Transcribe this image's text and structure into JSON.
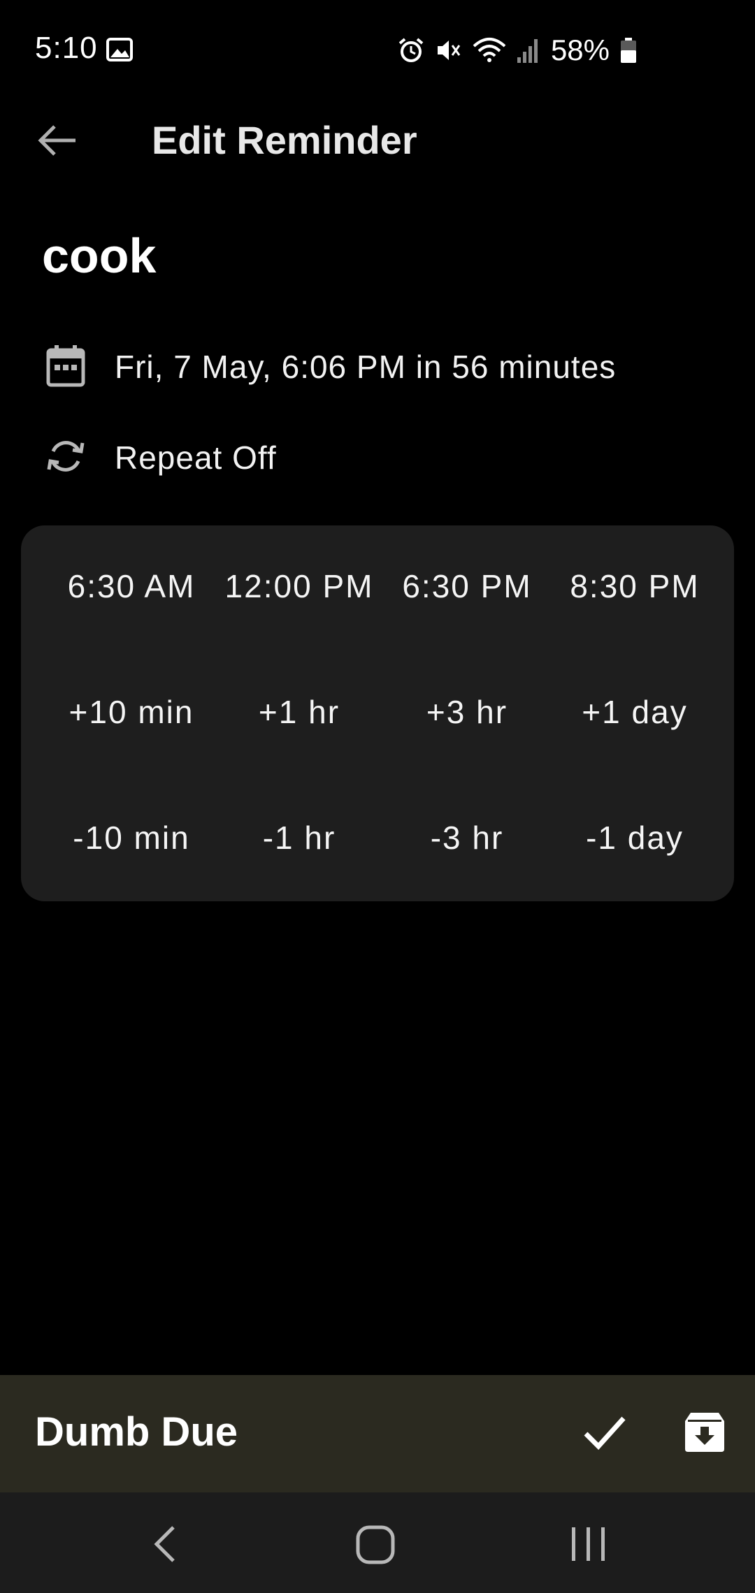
{
  "status_bar": {
    "time": "5:10",
    "battery": "58%",
    "icons": [
      "image-icon",
      "alarm-icon",
      "mute-icon",
      "wifi-icon",
      "signal-icon",
      "battery-icon"
    ]
  },
  "app_bar": {
    "title": "Edit Reminder",
    "back_icon": "arrow-left-icon"
  },
  "reminder": {
    "title": "cook",
    "date_text": "Fri, 7 May, 6:06 PM in 56 minutes",
    "date_icon": "calendar-icon",
    "repeat_text": "Repeat Off",
    "repeat_icon": "repeat-icon"
  },
  "quick_options": {
    "times": [
      "6:30 AM",
      "12:00 PM",
      "6:30 PM",
      "8:30 PM"
    ],
    "add": [
      "+10 min",
      "+1 hr",
      "+3 hr",
      "+1 day"
    ],
    "subtract": [
      "-10 min",
      "-1 hr",
      "-3 hr",
      "-1 day"
    ]
  },
  "bottom_bar": {
    "title": "Dumb Due",
    "done_icon": "check-icon",
    "archive_icon": "archive-icon"
  },
  "nav_bar": {
    "icons": [
      "nav-back-icon",
      "nav-home-icon",
      "nav-recents-icon"
    ]
  },
  "colors": {
    "background": "#000000",
    "card": "#1e1e1e",
    "bottom_bar": "#2b2a20",
    "nav_bar": "#1c1c1c",
    "text": "#ffffff",
    "icon": "#b8b8b8"
  }
}
